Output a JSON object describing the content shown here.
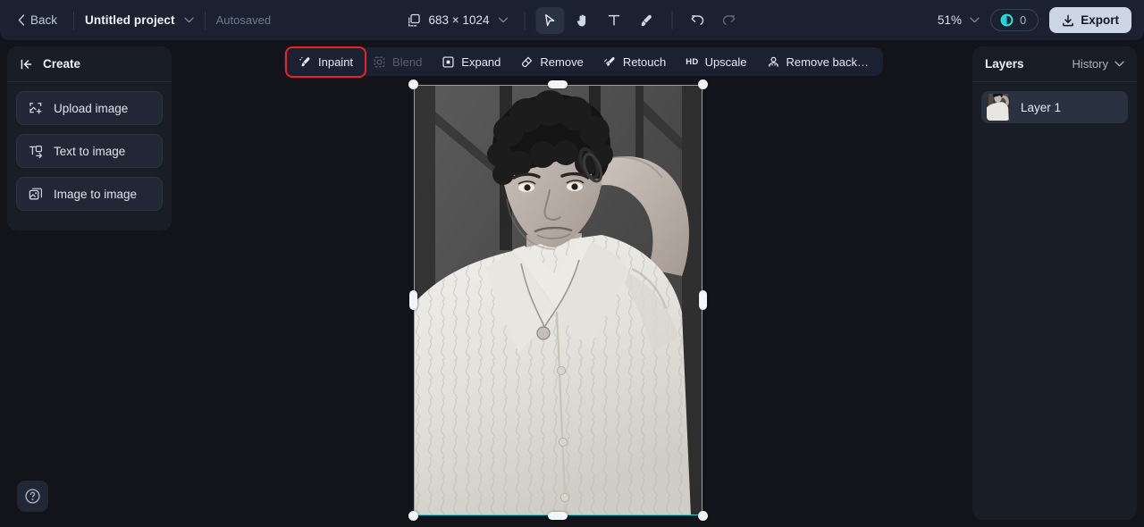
{
  "topbar": {
    "back_label": "Back",
    "project_name": "Untitled project",
    "autosaved_label": "Autosaved",
    "dimensions": "683 × 1024",
    "zoom_level": "51%",
    "credits_count": "0",
    "export_label": "Export",
    "tools": [
      {
        "name": "transform-icon",
        "label": "Transform"
      },
      {
        "name": "select-icon",
        "label": "Select",
        "active": true
      },
      {
        "name": "hand-icon",
        "label": "Pan"
      },
      {
        "name": "text-icon",
        "label": "Text"
      },
      {
        "name": "brush-icon",
        "label": "Brush"
      },
      {
        "name": "undo-icon",
        "label": "Undo"
      },
      {
        "name": "redo-icon",
        "label": "Redo",
        "disabled": true
      }
    ]
  },
  "create_panel": {
    "title": "Create",
    "items": [
      {
        "label": "Upload image",
        "icon": "upload-image-icon"
      },
      {
        "label": "Text to image",
        "icon": "text-to-image-icon"
      },
      {
        "label": "Image to image",
        "icon": "image-to-image-icon"
      }
    ]
  },
  "action_bar": {
    "actions": [
      {
        "label": "Inpaint",
        "icon": "inpaint-icon",
        "highlighted": true,
        "disabled": false
      },
      {
        "label": "Blend",
        "icon": "blend-icon",
        "highlighted": false,
        "disabled": true
      },
      {
        "label": "Expand",
        "icon": "expand-icon",
        "highlighted": false,
        "disabled": false
      },
      {
        "label": "Remove",
        "icon": "remove-icon",
        "highlighted": false,
        "disabled": false
      },
      {
        "label": "Retouch",
        "icon": "retouch-icon",
        "highlighted": false,
        "disabled": false
      },
      {
        "label": "Upscale",
        "icon": "hd-icon",
        "highlighted": false,
        "disabled": false
      },
      {
        "label": "Remove back…",
        "icon": "remove-background-icon",
        "highlighted": false,
        "disabled": false
      }
    ]
  },
  "layers_panel": {
    "title": "Layers",
    "history_label": "History",
    "layers": [
      {
        "name": "Layer 1"
      }
    ]
  },
  "help": {
    "label": "Help"
  },
  "colors": {
    "accent_cyan": "#22d3d8",
    "highlight_red": "#ef2222",
    "topbar_bg": "#1b2130",
    "panel_bg": "#191d26",
    "canvas_bg": "#121419",
    "export_bg": "#ccd6e4"
  }
}
